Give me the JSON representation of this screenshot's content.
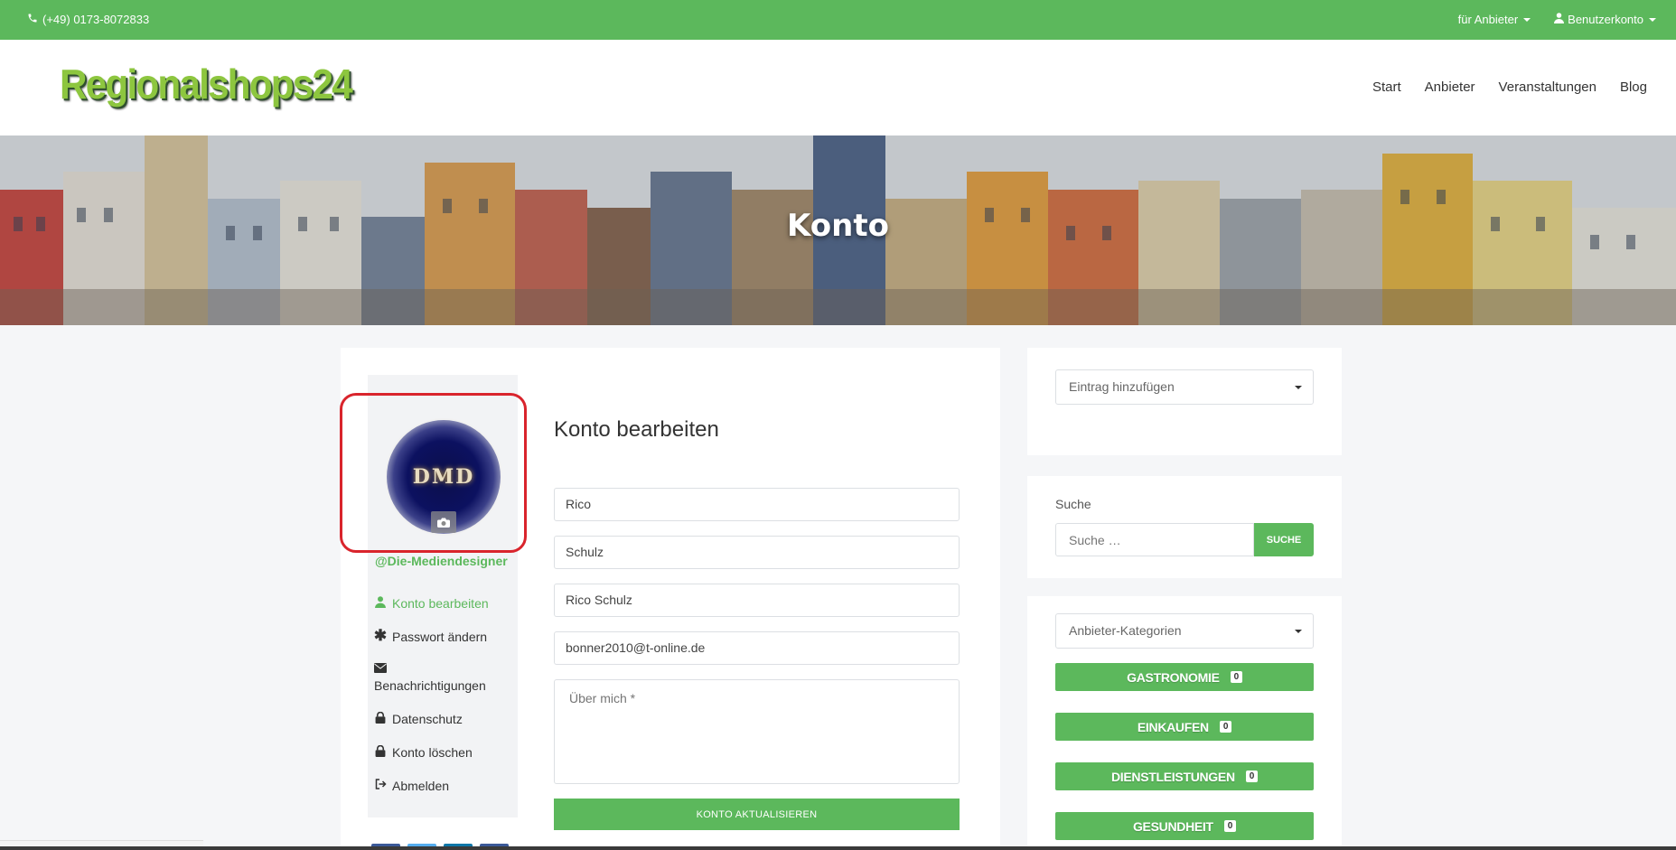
{
  "topbar": {
    "phone": "(+49) 0173-8072833",
    "provider_menu": "für Anbieter",
    "account_menu": "Benutzerkonto"
  },
  "header": {
    "logo": "Regionalshops24",
    "nav": [
      "Start",
      "Anbieter",
      "Veranstaltungen",
      "Blog"
    ]
  },
  "hero": {
    "title": "Konto"
  },
  "profile": {
    "avatar_text": "DMD",
    "username": "@Die-Mediendesigner",
    "menu": [
      {
        "label": "Konto bearbeiten",
        "icon": "user-icon"
      },
      {
        "label": "Passwort ändern",
        "icon": "asterisk-icon"
      },
      {
        "label": "Benachrichtigungen",
        "icon": "envelope-icon"
      },
      {
        "label": "Datenschutz",
        "icon": "lock-icon"
      },
      {
        "label": "Konto löschen",
        "icon": "lock-icon"
      },
      {
        "label": "Abmelden",
        "icon": "sign-out-icon"
      }
    ]
  },
  "form": {
    "title": "Konto bearbeiten",
    "first_name": "Rico",
    "last_name": "Schulz",
    "display_name": "Rico Schulz",
    "email": "bonner2010@t-online.de",
    "about_placeholder": "Über mich *",
    "submit_label": "KONTO AKTUALISIEREN"
  },
  "widgets": {
    "add_entry": "Eintrag hinzufügen",
    "search_label": "Suche",
    "search_placeholder": "Suche …",
    "search_button": "SUCHE",
    "categories_select": "Anbieter-Kategorien",
    "categories": [
      {
        "name": "GASTRONOMIE",
        "count": "0"
      },
      {
        "name": "EINKAUFEN",
        "count": "0"
      },
      {
        "name": "DIENSTLEISTUNGEN",
        "count": "0"
      },
      {
        "name": "GESUNDHEIT",
        "count": "0"
      }
    ]
  },
  "colors": {
    "brand_green": "#5cb85c",
    "highlight_red": "#d9242c"
  }
}
